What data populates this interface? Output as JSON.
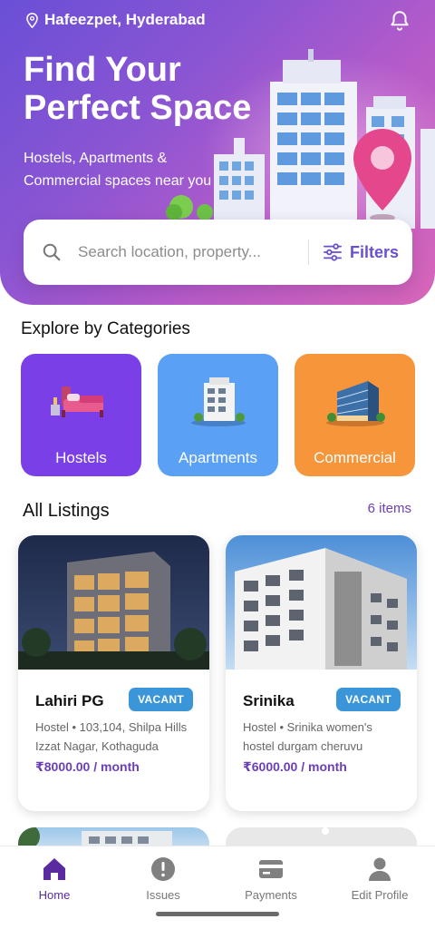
{
  "header": {
    "location": "Hafeezpet, Hyderabad",
    "title": "Find Your Perfect Space",
    "subtitle": "Hostels, Apartments & Commercial spaces near you"
  },
  "search": {
    "placeholder": "Search location, property...",
    "filters_label": "Filters"
  },
  "categories": {
    "title": "Explore by Categories",
    "items": [
      {
        "label": "Hostels",
        "color": "#7b3fe8",
        "icon": "bed-icon"
      },
      {
        "label": "Apartments",
        "color": "#5aa0f5",
        "icon": "apartment-building-icon"
      },
      {
        "label": "Commercial",
        "color": "#f7953a",
        "icon": "commercial-building-icon"
      }
    ]
  },
  "listings": {
    "title": "All Listings",
    "count": "6 items",
    "items": [
      {
        "name": "Lahiri PG",
        "status": "VACANT",
        "description": "Hostel • 103,104, Shilpa Hills Izzat Nagar, Kothaguda",
        "price": "₹8000.00 / month"
      },
      {
        "name": "Srinika",
        "status": "VACANT",
        "description": "Hostel • Srinika women's hostel durgam cheruvu",
        "price": "₹6000.00 / month"
      }
    ]
  },
  "nav": {
    "items": [
      {
        "label": "Home",
        "icon": "home-icon",
        "active": true
      },
      {
        "label": "Issues",
        "icon": "alert-icon",
        "active": false
      },
      {
        "label": "Payments",
        "icon": "card-icon",
        "active": false
      },
      {
        "label": "Edit Profile",
        "icon": "person-icon",
        "active": false
      }
    ]
  },
  "colors": {
    "accent": "#6b3fb5",
    "badge": "#3b96d9"
  }
}
